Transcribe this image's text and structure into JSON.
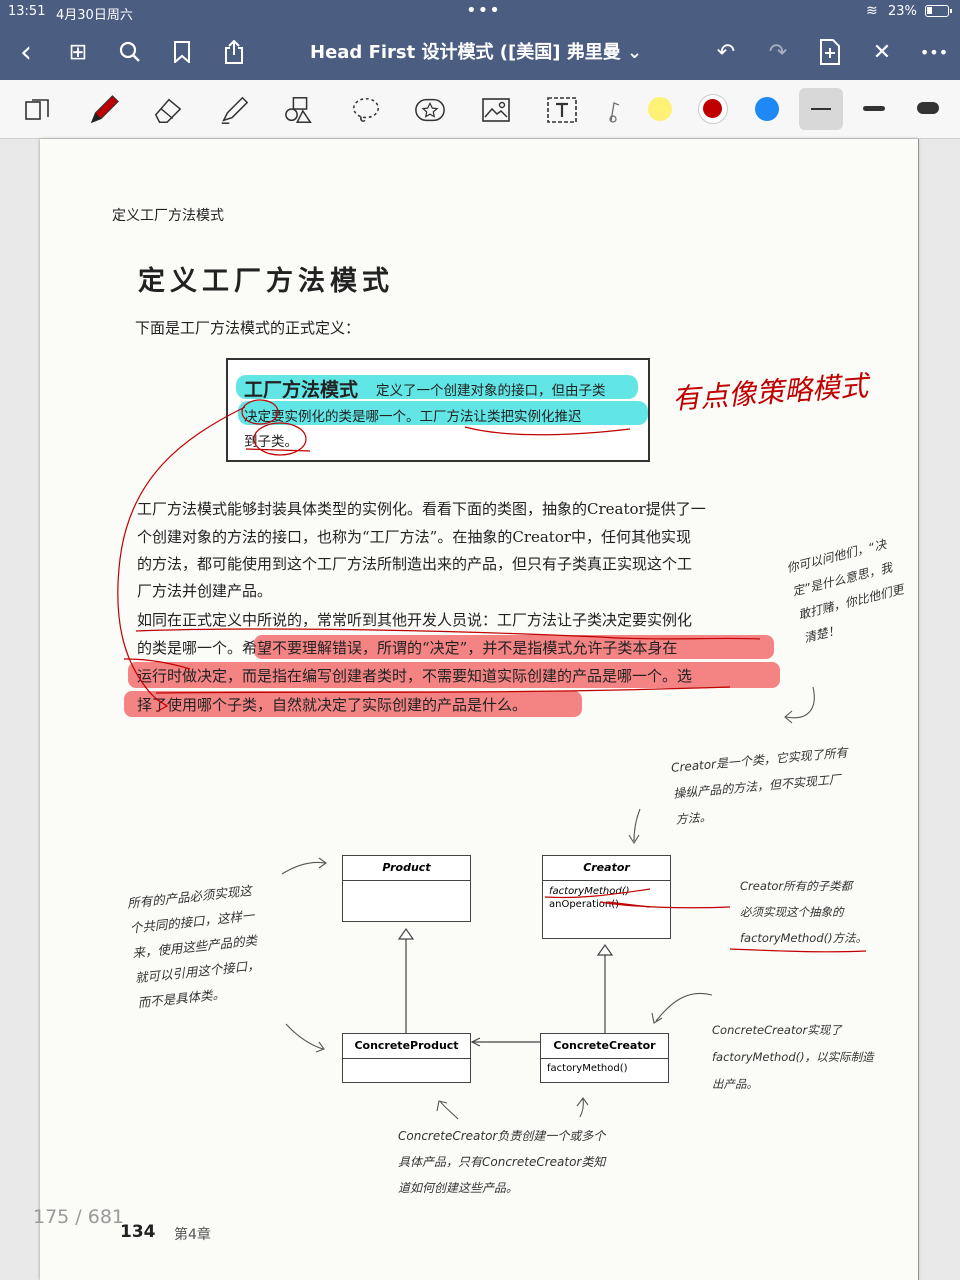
{
  "status": {
    "time": "13:51",
    "date": "4月30日周六",
    "battery": "23%"
  },
  "doc_title": "Head First 设计模式 ([美国] 弗里曼",
  "chevron": "⌄",
  "icons": {
    "back": "‹",
    "grid": "⊞",
    "search": "⌕",
    "bookmark": "⌑",
    "share": "⇪",
    "undo": "↶",
    "redo": "↷",
    "add_page": "⊕",
    "close": "✕",
    "more": "•••"
  },
  "colors": {
    "yellow": "#fff176",
    "red": "#c00000",
    "blue": "#1e88f5"
  },
  "page": {
    "header": "定义工厂方法模式",
    "heading": "定义工厂方法模式",
    "intro": "下面是工厂方法模式的正式定义：",
    "definition_bold": "工厂方法模式",
    "definition_lines": [
      "定义了一个创建对象的接口，但由子类",
      "决定要实例化的类是哪一个。工厂方法让类把实例化推迟",
      "到子类。"
    ],
    "body": [
      "工厂方法模式能够封装具体类型的实例化。看看下面的类图，抽象的Creator提供了一",
      "个创建对象的方法的接口，也称为“工厂方法”。在抽象的Creator中，任何其他实现",
      "的方法，都可能使用到这个工厂方法所制造出来的产品，但只有子类真正实现这个工",
      "厂方法并创建产品。",
      "如同在正式定义中所说的，常常听到其他开发人员说：工厂方法让子类决定要实例化",
      "的类是哪一个。希望不要理解错误，所谓的“决定”，并不是指模式允许子类本身在",
      "运行时做决定，而是指在编写创建者类时，不需要知道实际创建的产品是哪一个。选",
      "择了使用哪个子类，自然就决定了实际创建的产品是什么。"
    ],
    "handwritten_note": "有点像策略模式",
    "side_note": [
      "你可以问他们，“决",
      "定”是什么意思，我",
      "敢打赌，你比他们更",
      "清楚！"
    ],
    "uml": {
      "product": "Product",
      "creator": "Creator",
      "creator_methods": [
        "factoryMethod()",
        "anOperation()"
      ],
      "concrete_product": "ConcreteProduct",
      "concrete_creator": "ConcreteCreator",
      "concrete_methods": [
        "factoryMethod()"
      ]
    },
    "annotations": {
      "creator": [
        "Creator是一个类，它实现了所有",
        "操纵产品的方法，但不实现工厂",
        "方法。"
      ],
      "product": [
        "所有的产品必须实现这",
        "个共同的接口，这样一",
        "来，使用这些产品的类",
        "就可以引用这个接口，",
        "而不是具体类。"
      ],
      "subclasses": [
        "Creator所有的子类都",
        "必须实现这个抽象的",
        "factoryMethod()方法。"
      ],
      "concrete_creator": [
        "ConcreteCreator实现了",
        "factoryMethod()，以实际制造",
        "出产品。"
      ],
      "bottom": [
        "ConcreteCreator负责创建一个或多个",
        "具体产品，只有ConcreteCreator类知",
        "道如何创建这些产品。"
      ]
    },
    "page_number": "134",
    "chapter": "第4章"
  },
  "page_counter": "175 / 681"
}
